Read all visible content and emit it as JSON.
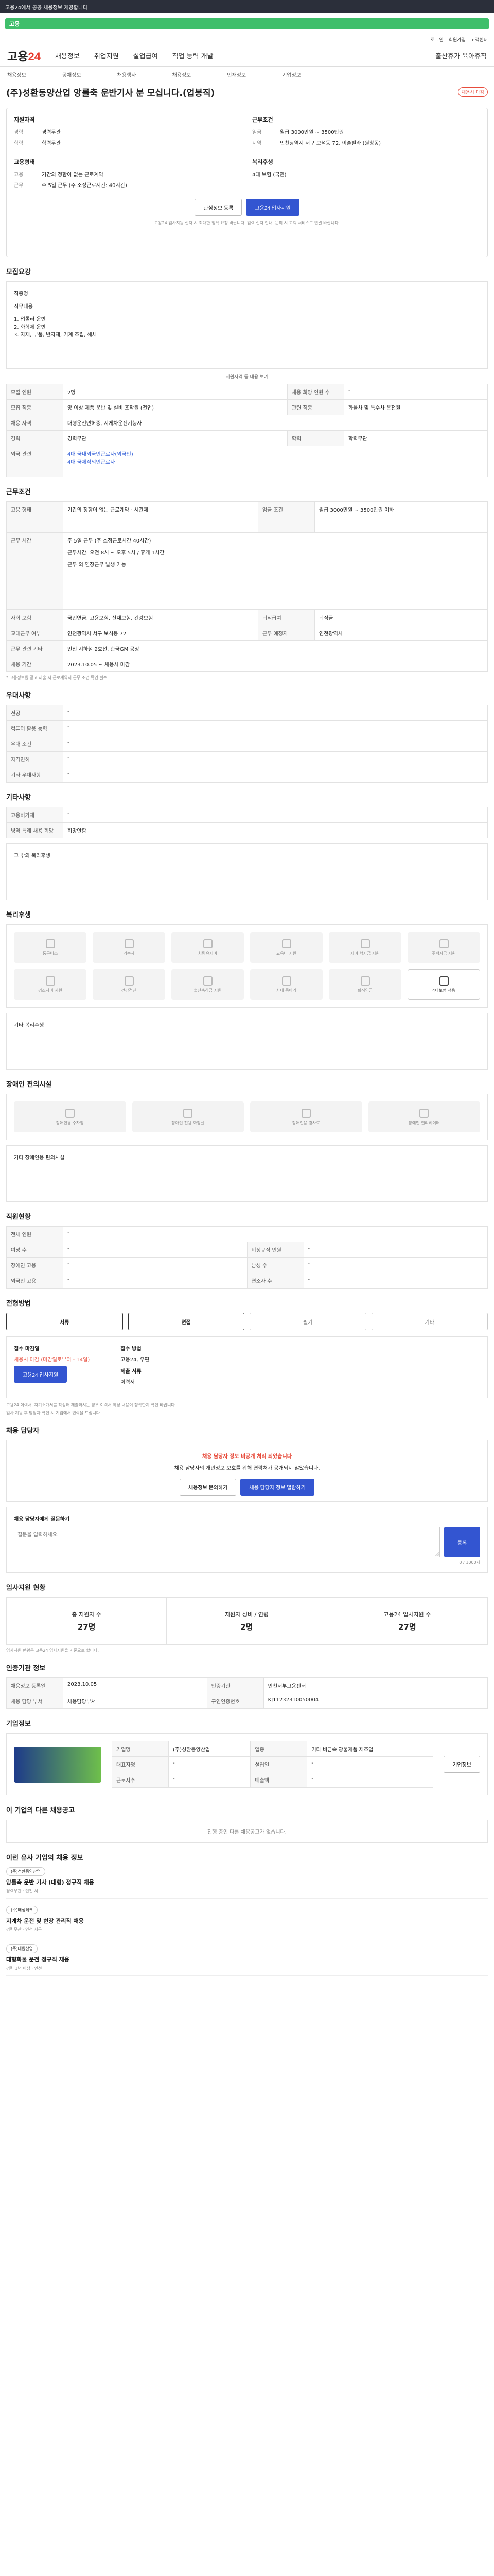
{
  "topbar": {
    "text": "고용24에서 공공 채용정보 제공합니다"
  },
  "search": {
    "label": "고용"
  },
  "utils": [
    "로그인",
    "회원가입",
    "고객센터"
  ],
  "gnb": {
    "logo_main": "고용",
    "logo_accent": "24",
    "items": [
      "채용정보",
      "취업지원",
      "실업급여",
      "직업 능력 개발",
      "출산휴가 육아휴직"
    ]
  },
  "subnav": [
    "채용정보",
    "공채정보",
    "채용행사",
    "채용정보",
    "인재정보",
    "기업정보"
  ],
  "job": {
    "badge": "채용시 마감",
    "title": "(주)성환동양산업 앙롤축 운반기사 분 모십니다.(업봉직)",
    "left_head": "지원자격",
    "left": [
      {
        "k": "경력",
        "v": "경력무관"
      },
      {
        "k": "학력",
        "v": "학력무관"
      }
    ],
    "right_head": "근무조건",
    "right": [
      {
        "k": "임금",
        "v": "월급 3000만원 ~ 3500만원"
      },
      {
        "k": "지역",
        "v": "인천광역시 서구 보석동 72, 이솔빌라 (원창동)"
      }
    ],
    "left2_head": "고용형태",
    "left2": [
      {
        "k": "고용",
        "v": "기간의 정함이 없는 근로계약"
      },
      {
        "k": "근무",
        "v": "주 5일 근무 (주 소정근로시간: 40시간)"
      }
    ],
    "right2_head": "복리후생",
    "right2": [
      {
        "k": "",
        "v": "4대 보험 (국민)"
      }
    ],
    "btn_scrap": "관심정보 등록",
    "btn_apply": "고용24 입사지원",
    "notice": "고용24 입사지원 절차 시 최대한 정확 요청 바랍니다. 입력 절차 안내, 문의 시 고객 서비스로 연결 바랍니다."
  },
  "sections": {
    "recruit": "모집요강",
    "work": "근무조건",
    "prefer": "우대사항",
    "etc": "기타사항",
    "welfare": "복리후생",
    "disabled": "장애인 편의시설",
    "company": "직원현황",
    "process": "전형방법",
    "manager": "채용 담당자",
    "stats": "입사지원 현황",
    "info": "인증기관 정보",
    "firm": "기업정보",
    "related": "이 기업의 다른 채용공고",
    "similar": "이런 유사 기업의 채용 정보",
    "recommend": "채용정보 추천 정보"
  },
  "recruit_text": [
    "직종명",
    "직무내용",
    "1. 업롤러 운반",
    "2. 화학제 운반",
    "3. 자재, 부품, 반자재, 기계 조립, 해체"
  ],
  "recruit_more": "지원자격 등 내용 보기",
  "recruit_rows": [
    {
      "k": "모집 인원",
      "v": "2명",
      "k2": "채용 희망 인원 수",
      "v2": "-"
    },
    {
      "k": "모집 직종",
      "v": "앙 이상 제품 운반 및 설비 조작원 (전업)",
      "k2": "관련 직종",
      "v2": "화물차 및 특수차 운전원"
    },
    {
      "k": "채용 자격",
      "v": "대형운전면허증, 지게차운전기능사"
    },
    {
      "k": "경력",
      "v": "경력무관",
      "k2": "학력",
      "v2": "학력무관"
    }
  ],
  "language_label": "외국 관련",
  "languages": [
    "4대 국내외국인근로자(외국인)",
    "4대 국제적외인근로자"
  ],
  "work_rows": [
    {
      "k": "고용 형태",
      "v": "기간의 정함이 없는 근로계약 · 시간제",
      "k2": "임금 조건",
      "v2": "월급 3000만원 ~ 3500만원 이하"
    },
    {
      "k": "근무 시간",
      "v": "주 5일 근무 (주 소정근로시간 40시간)"
    },
    {
      "k": "근무 지역",
      "v": "인천광역시 서구 보석동 72, 이솔빌라 (원창동)"
    },
    {
      "k": "퇴직 급여",
      "v": "퇴직금 지급"
    },
    {
      "k": "사회 보험",
      "v": "국민연금, 고용보험, 산재보험, 건강보험",
      "k2": "퇴직급여",
      "v2": "퇴직금"
    },
    {
      "k": "교대근무 여부",
      "v": "인천광역시 서구 보석동 72",
      "k2": "근무 예정지",
      "v2": "인천광역시"
    },
    {
      "k": "근무 관련 기타",
      "v": "인천 지하철 2호선, 한국GM 공장"
    },
    {
      "k": "채용 기간",
      "v": "2023.10.05 ~ 채용시 마감"
    }
  ],
  "work_schedule": [
    "주 5일 근무 (주 소정근로시간 40시간)",
    "근무시간: 오전 8시 ~ 오후 5시 / 휴게 1시간",
    "근무 외 연장근무 발생 가능"
  ],
  "work_note": "* 고용정보원 공고 제출 시 근로계약서 근무 조건 확인 필수",
  "prefer_rows": [
    {
      "k": "전공",
      "v": "-"
    },
    {
      "k": "컴퓨터 활용 능력",
      "v": "-"
    },
    {
      "k": "우대 조건",
      "v": "-"
    },
    {
      "k": "자격면허",
      "v": "-"
    },
    {
      "k": "기타 우대사항",
      "v": "-"
    }
  ],
  "etc_rows": [
    {
      "k": "고용허가제",
      "v": "-"
    },
    {
      "k": "병역 특례 채용 희망",
      "v": "희망안함"
    }
  ],
  "etc_box": "그 밖의 복리후생",
  "welfare_icons": [
    "통근버스",
    "기숙사",
    "차량유지비",
    "교육비 지원",
    "자녀 학자금 지원",
    "주택자금 지원",
    "경조사비 지원",
    "건강검진",
    "출산축하금 지원",
    "사내 동아리",
    "퇴직연금",
    "4대보험 적용"
  ],
  "welfare_box": "기타 복리후생",
  "disabled_icons": [
    "장애인용 주차장",
    "장애인 전용 화장실",
    "장애인용 경사로",
    "장애인 엘리베이터"
  ],
  "disabled_box": "기타 장애인용 편의시설",
  "company_rows": [
    {
      "k": "전체 인원",
      "v": "-"
    },
    {
      "k": "여성 수",
      "v": "-",
      "k2": "비정규직 인원",
      "v2": "-"
    },
    {
      "k": "장애인 고용",
      "v": "-",
      "k2": "남성 수",
      "v2": "-"
    },
    {
      "k": "외국인 고용",
      "v": "-",
      "k2": "연소자 수",
      "v2": "-"
    }
  ],
  "process_tabs": [
    "서류",
    "면접",
    "필기",
    "기타"
  ],
  "process_info": {
    "k": "접수 마감일",
    "v": "채용시 마감 (마감일로부터 - 14일)",
    "k2": "접수 방법",
    "v2": "고용24, 우편",
    "k3": "제출 서류",
    "v3": "이력서",
    "apply": "고용24 입사지원"
  },
  "process_notes": [
    "고용24 이력서, 자기소개서를 작성해 제출하시는 경우 이력서 작성 내용이 정확한지 확인 바랍니다.",
    "입사 지원 후 담당자 확인 시 기업에서 연락을 드립니다."
  ],
  "manager": {
    "alert": "채용 담당자 정보 비공개 처리 되었습니다",
    "desc": "채용 담당자의 개인정보 보호를 위해 연락처가 공개되지 않았습니다.",
    "btn1": "채용정보 문의하기",
    "btn2": "채용 담당자 정보 열람하기",
    "qa_label": "채용 담당자에게 질문하기",
    "qa_placeholder": "질문을 입력하세요.",
    "qa_btn": "등록",
    "qa_count": "0 / 1000자"
  },
  "stats": [
    {
      "label": "총 지원자 수",
      "num": "27명"
    },
    {
      "label": "지원자 성비 / 연령",
      "num": "2명"
    },
    {
      "label": "고용24 입사지원 수",
      "num": "27명"
    }
  ],
  "stats_note": "입사지원 현황은 고용24 입사지원을 기준으로 합니다.",
  "info_rows": [
    {
      "k": "채용정보 등록일",
      "v": "2023.10.05",
      "k2": "인증기관",
      "v2": "인천서부고용센터"
    },
    {
      "k": "채용 담당 부서",
      "v": "채용담당부서",
      "k2": "구인인증번호",
      "v2": "KJ11232310050004"
    }
  ],
  "firm": {
    "rows": [
      {
        "k": "기업명",
        "v": "(주)성환동양산업",
        "k2": "업종",
        "v2": "기타 비금속 광물제품 제조업"
      },
      {
        "k": "대표자명",
        "v": "-",
        "k2": "설립일",
        "v2": "-"
      },
      {
        "k": "근로자수",
        "v": "-",
        "k2": "매출액",
        "v2": "-"
      }
    ],
    "btn": "기업정보"
  },
  "related_empty": "진행 중인 다른 채용공고가 없습니다.",
  "similar": [
    {
      "tag": "(주)성환동양산업",
      "title": "앙롤축 운반 기사 (대형) 정규직 채용",
      "meta": "경력무관 · 인천 서구"
    },
    {
      "tag": "(주)태성테크",
      "title": "지게차 운전 및 현장 관리직 채용",
      "meta": "경력무관 · 인천 서구"
    },
    {
      "tag": "(주)대원산업",
      "title": "대형화물 운전 정규직 채용",
      "meta": "경력 1년 이상 · 인천"
    }
  ]
}
